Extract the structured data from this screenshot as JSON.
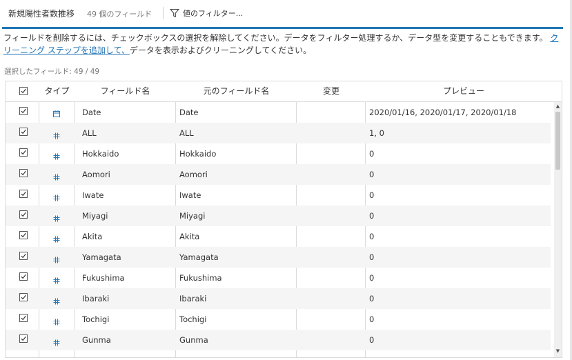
{
  "toolbar": {
    "title": "新規陽性者数推移",
    "field_count": "49 個のフィールド",
    "filter_label": "値のフィルター..."
  },
  "info": {
    "text1": "フィールドを削除するには、チェックボックスの選択を解除してください。データをフィルター処理するか、データ型を変更することもできます。",
    "link": "クリーニング ステップを追加して、",
    "text2": "データを表示およびクリーニングしてください。"
  },
  "selected_label": "選択したフィールド: 49 / 49",
  "table": {
    "headers": {
      "type": "タイプ",
      "field": "フィールド名",
      "original": "元のフィールド名",
      "change": "変更",
      "preview": "プレビュー"
    },
    "rows": [
      {
        "type": "date",
        "field": "Date",
        "original": "Date",
        "change": "",
        "preview": "2020/01/16, 2020/01/17, 2020/01/18"
      },
      {
        "type": "number",
        "field": "ALL",
        "original": "ALL",
        "change": "",
        "preview": "1, 0"
      },
      {
        "type": "number",
        "field": "Hokkaido",
        "original": "Hokkaido",
        "change": "",
        "preview": "0"
      },
      {
        "type": "number",
        "field": "Aomori",
        "original": "Aomori",
        "change": "",
        "preview": "0"
      },
      {
        "type": "number",
        "field": "Iwate",
        "original": "Iwate",
        "change": "",
        "preview": "0"
      },
      {
        "type": "number",
        "field": "Miyagi",
        "original": "Miyagi",
        "change": "",
        "preview": "0"
      },
      {
        "type": "number",
        "field": "Akita",
        "original": "Akita",
        "change": "",
        "preview": "0"
      },
      {
        "type": "number",
        "field": "Yamagata",
        "original": "Yamagata",
        "change": "",
        "preview": "0"
      },
      {
        "type": "number",
        "field": "Fukushima",
        "original": "Fukushima",
        "change": "",
        "preview": "0"
      },
      {
        "type": "number",
        "field": "Ibaraki",
        "original": "Ibaraki",
        "change": "",
        "preview": "0"
      },
      {
        "type": "number",
        "field": "Tochigi",
        "original": "Tochigi",
        "change": "",
        "preview": "0"
      },
      {
        "type": "number",
        "field": "Gunma",
        "original": "Gunma",
        "change": "",
        "preview": "0"
      }
    ]
  },
  "icons": {
    "date": "calendar-icon",
    "number": "hash-icon",
    "filter": "funnel-icon"
  },
  "colors": {
    "accent": "#1f77b4",
    "link": "#1a6fb3",
    "type_icon": "#2a7ab8"
  }
}
